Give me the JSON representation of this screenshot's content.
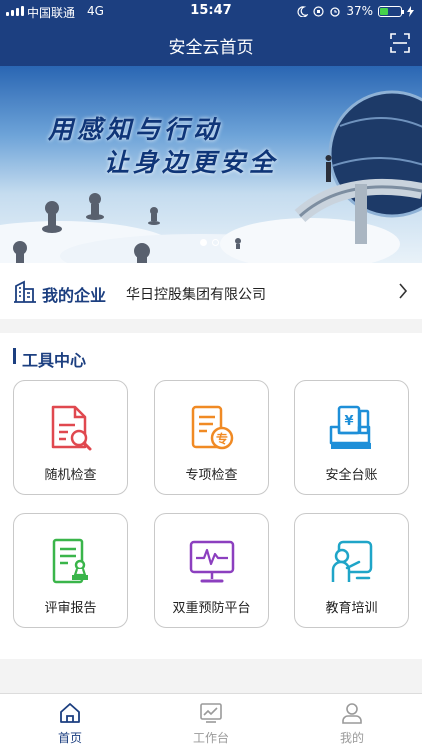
{
  "status_bar": {
    "carrier": "中国联通",
    "network": "4G",
    "time": "15:47",
    "battery": "37%"
  },
  "nav": {
    "title": "安全云首页",
    "scan_icon": "scan-icon"
  },
  "banner": {
    "line1": "用感知与行动",
    "line2": "让身边更安全",
    "page_count": 2,
    "current_page": 1
  },
  "company": {
    "label": "我的企业",
    "name": "华日控股集团有限公司"
  },
  "tools": {
    "title": "工具中心",
    "items": [
      {
        "label": "随机检查",
        "icon": "random-check-icon",
        "color": "#e0484f"
      },
      {
        "label": "专项检查",
        "icon": "special-check-icon",
        "color": "#f08a24"
      },
      {
        "label": "安全台账",
        "icon": "safety-ledger-icon",
        "color": "#1e8fd8"
      },
      {
        "label": "评审报告",
        "icon": "review-report-icon",
        "color": "#3ab54a"
      },
      {
        "label": "双重预防平台",
        "icon": "dual-prevention-icon",
        "color": "#8c3fbf"
      },
      {
        "label": "教育培训",
        "icon": "training-icon",
        "color": "#1fa5c8"
      }
    ]
  },
  "tabbar": {
    "tabs": [
      {
        "label": "首页",
        "icon": "home-icon",
        "active": true
      },
      {
        "label": "工作台",
        "icon": "workbench-icon",
        "active": false
      },
      {
        "label": "我的",
        "icon": "profile-icon",
        "active": false
      }
    ]
  },
  "colors": {
    "primary": "#1c3f80",
    "background": "#f3f3f3",
    "battery_green": "#45d14a"
  }
}
